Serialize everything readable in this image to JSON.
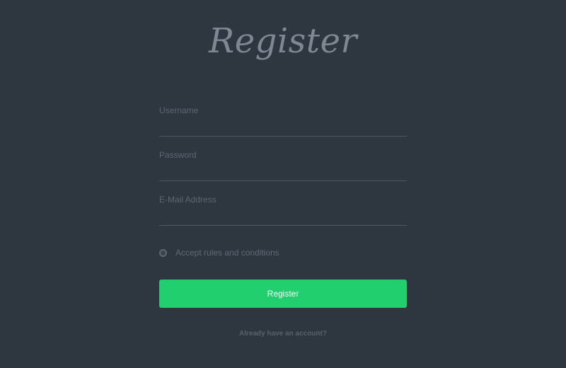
{
  "page": {
    "title": "Register"
  },
  "form": {
    "username_placeholder": "Username",
    "password_placeholder": "Password",
    "email_placeholder": "E-Mail Address",
    "accept_label": "Accept rules and conditions",
    "submit_label": "Register",
    "account_link": "Already have an account?"
  },
  "colors": {
    "background": "#2e3640",
    "accent": "#22cf6e",
    "muted_text": "#5f6a76"
  }
}
